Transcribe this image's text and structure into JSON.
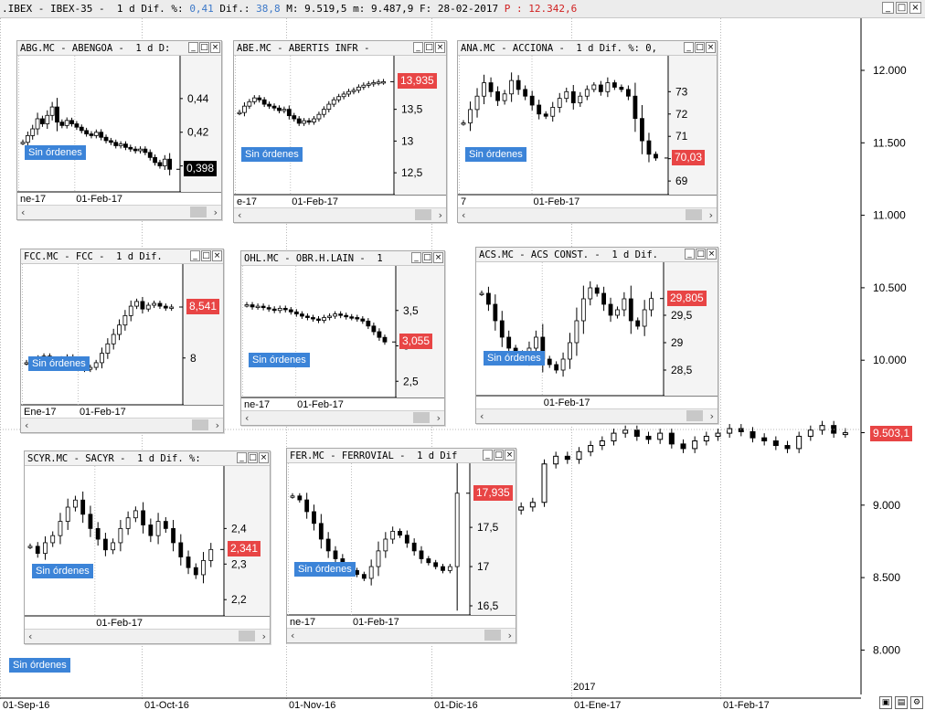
{
  "header": {
    "prefix": ".IBEX - IBEX-35 -  1 d Dif. %: ",
    "dif_pct": "0,41",
    "dif_label": " Dif.: ",
    "dif": "38,8",
    "rest": " M: 9.519,5 m: 9.487,9 F: 28-02-2017 ",
    "p_label": "P : 12.342,6",
    "minimize": "_",
    "maximize": "□",
    "close": "×"
  },
  "main": {
    "sin_ordenes": "Sin órdenes",
    "last_label": "9.503,1",
    "y_ticks": [
      "12.000",
      "11.500",
      "11.000",
      "10.500",
      "10.000",
      "9.500",
      "9.000",
      "8.500",
      "8.000"
    ],
    "x_ticks": [
      "01-Sep-16",
      "01-Oct-16",
      "01-Nov-16",
      "01-Dic-16",
      "01-Ene-17",
      "01-Feb-17"
    ],
    "year_label": "2017",
    "colors": {
      "label_red": "#e84545",
      "sin_blue": "#3c84d8",
      "bg": "#ffffff"
    }
  },
  "chart_data": [
    {
      "type": "candlestick",
      "title": "ABG.MC - ABENGOA -  1 d D:",
      "y_ticks": [
        "0,44",
        "0,42",
        "0,40"
      ],
      "x_ticks": [
        "ne-17",
        "01-Feb-17"
      ],
      "last_label": "0,398",
      "ylim": [
        0.39,
        0.46
      ],
      "values": [
        0.414,
        0.418,
        0.422,
        0.428,
        0.425,
        0.43,
        0.435,
        0.426,
        0.424,
        0.427,
        0.425,
        0.423,
        0.421,
        0.419,
        0.418,
        0.42,
        0.417,
        0.415,
        0.414,
        0.412,
        0.413,
        0.411,
        0.41,
        0.409,
        0.41,
        0.408,
        0.405,
        0.402,
        0.4,
        0.404,
        0.398
      ]
    },
    {
      "type": "candlestick",
      "title": "ABE.MC - ABERTIS INFR -",
      "y_ticks": [
        "13,5",
        "13",
        "12,5"
      ],
      "x_ticks": [
        "e-17",
        "01-Feb-17"
      ],
      "last_label": "13,935",
      "ylim": [
        12.3,
        14.2
      ],
      "values": [
        13.45,
        13.55,
        13.62,
        13.68,
        13.65,
        13.58,
        13.55,
        13.52,
        13.48,
        13.5,
        13.4,
        13.35,
        13.28,
        13.32,
        13.3,
        13.35,
        13.42,
        13.5,
        13.58,
        13.65,
        13.7,
        13.74,
        13.78,
        13.8,
        13.85,
        13.88,
        13.9,
        13.92,
        13.93,
        13.935
      ]
    },
    {
      "type": "candlestick",
      "title": "ANA.MC - ACCIONA -  1 d Dif. %: 0,",
      "y_ticks": [
        "73",
        "72",
        "71",
        "70",
        "69"
      ],
      "x_ticks": [
        "7",
        "01-Feb-17"
      ],
      "last_label": "70,03",
      "ylim": [
        68.8,
        74.2
      ],
      "values": [
        71.6,
        72.2,
        72.8,
        73.4,
        73.0,
        72.6,
        72.9,
        73.5,
        73.1,
        72.8,
        72.4,
        72.0,
        71.9,
        72.3,
        72.7,
        73.0,
        72.5,
        72.8,
        73.1,
        73.3,
        73.0,
        73.4,
        73.2,
        73.1,
        72.8,
        71.8,
        70.8,
        70.2,
        70.03
      ]
    },
    {
      "type": "candlestick",
      "title": "FCC.MC - FCC -  1 d Dif.",
      "y_ticks": [
        "8"
      ],
      "x_ticks": [
        "Ene-17",
        "01-Feb-17"
      ],
      "last_label": "8,541",
      "ylim": [
        7.6,
        8.9
      ],
      "values": [
        7.95,
        7.98,
        8.0,
        8.02,
        7.98,
        7.96,
        7.99,
        8.01,
        7.97,
        7.92,
        7.88,
        7.9,
        7.95,
        8.05,
        8.15,
        8.25,
        8.35,
        8.45,
        8.55,
        8.6,
        8.52,
        8.56,
        8.58,
        8.55,
        8.53,
        8.541
      ]
    },
    {
      "type": "candlestick",
      "title": "OHL.MC - OBR.H.LAIN -  1",
      "y_ticks": [
        "3,5",
        "3",
        "2,5"
      ],
      "x_ticks": [
        "ne-17",
        "01-Feb-17"
      ],
      "last_label": "3,055",
      "ylim": [
        2.4,
        4.0
      ],
      "values": [
        3.58,
        3.55,
        3.56,
        3.54,
        3.52,
        3.5,
        3.53,
        3.51,
        3.48,
        3.45,
        3.42,
        3.4,
        3.38,
        3.36,
        3.4,
        3.42,
        3.45,
        3.43,
        3.41,
        3.4,
        3.38,
        3.35,
        3.28,
        3.2,
        3.12,
        3.055
      ]
    },
    {
      "type": "candlestick",
      "title": "ACS.MC - ACS CONST. -  1 d Dif.",
      "y_ticks": [
        "29,5",
        "29",
        "28,5"
      ],
      "x_ticks": [
        "01-Feb-17"
      ],
      "last_label": "29,805",
      "ylim": [
        28.2,
        30.3
      ],
      "values": [
        29.9,
        29.7,
        29.4,
        29.1,
        28.9,
        28.8,
        28.7,
        28.9,
        29.1,
        28.7,
        28.6,
        28.5,
        28.7,
        29.0,
        29.4,
        29.8,
        30.0,
        29.9,
        29.7,
        29.5,
        29.6,
        29.8,
        29.4,
        29.3,
        29.6,
        29.805
      ]
    },
    {
      "type": "candlestick",
      "title": "SCYR.MC - SACYR -  1 d Dif. %:",
      "y_ticks": [
        "2,4",
        "2,3",
        "2,2"
      ],
      "x_ticks": [
        "01-Feb-17"
      ],
      "last_label": "2,341",
      "ylim": [
        2.18,
        2.55
      ],
      "values": [
        2.35,
        2.33,
        2.36,
        2.38,
        2.42,
        2.46,
        2.48,
        2.44,
        2.4,
        2.37,
        2.34,
        2.36,
        2.4,
        2.43,
        2.45,
        2.41,
        2.38,
        2.42,
        2.4,
        2.36,
        2.32,
        2.29,
        2.27,
        2.31,
        2.341
      ]
    },
    {
      "type": "candlestick",
      "title": "FER.MC - FERROVIAL -  1 d Dif",
      "y_ticks": [
        "17,5",
        "17",
        "16,5"
      ],
      "x_ticks": [
        "ne-17",
        "01-Feb-17"
      ],
      "last_label": "17,935",
      "ylim": [
        16.5,
        18.2
      ],
      "values": [
        17.9,
        17.85,
        17.7,
        17.55,
        17.35,
        17.2,
        17.1,
        17.0,
        16.95,
        16.9,
        16.85,
        17.0,
        17.2,
        17.35,
        17.45,
        17.4,
        17.3,
        17.2,
        17.1,
        17.05,
        17.0,
        16.95,
        17.0,
        17.935
      ]
    },
    {
      "type": "candlestick",
      "title": "IBEX-35 main",
      "ylim": [
        7.8,
        12.2
      ],
      "values": [
        9.0,
        9.02,
        9.05,
        9.3,
        9.35,
        9.33,
        9.38,
        9.42,
        9.45,
        9.5,
        9.52,
        9.48,
        9.46,
        9.5,
        9.43,
        9.4,
        9.45,
        9.48,
        9.5,
        9.53,
        9.51,
        9.47,
        9.45,
        9.42,
        9.4,
        9.48,
        9.52,
        9.55,
        9.5,
        9.503
      ]
    }
  ]
}
